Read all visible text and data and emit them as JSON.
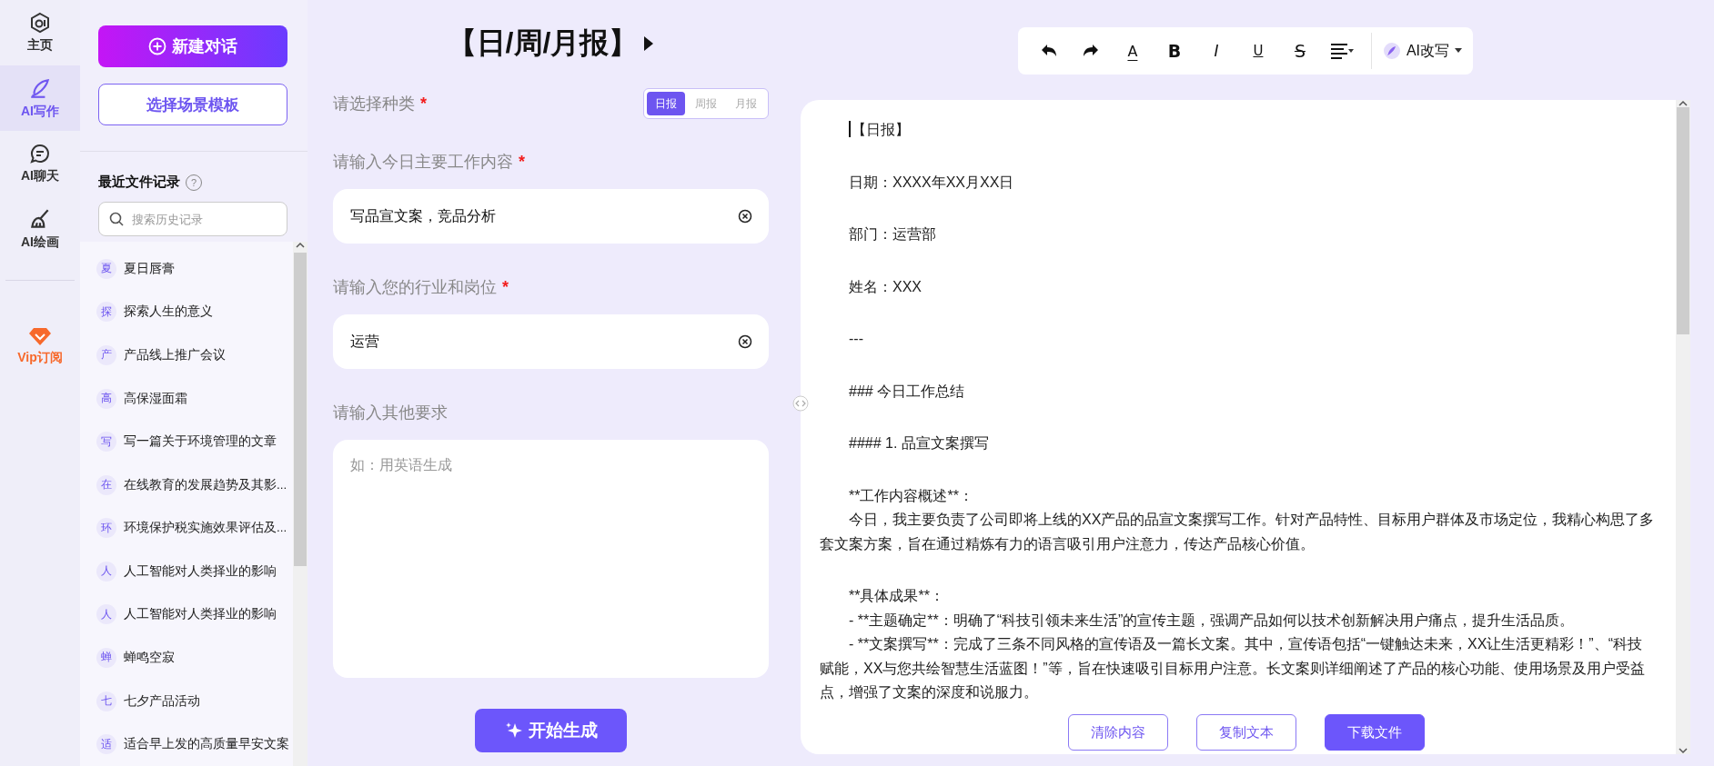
{
  "nav": [
    {
      "kind": "home",
      "label": "主页",
      "selected": false
    },
    {
      "kind": "pen",
      "label": "AI写作",
      "selected": true
    },
    {
      "kind": "chat",
      "label": "AI聊天",
      "selected": false
    },
    {
      "kind": "brush",
      "label": "AI绘画",
      "selected": false
    },
    {
      "kind": "vip",
      "label": "Vip订阅",
      "selected": false
    }
  ],
  "sidebar": {
    "new_chat": "新建对话",
    "template": "选择场景模板",
    "recent_title": "最近文件记录",
    "help_mark": "?",
    "search": {
      "placeholder": "搜索历史记录"
    },
    "files": [
      {
        "initial": "夏",
        "title": "夏日唇膏"
      },
      {
        "initial": "探",
        "title": "探索人生的意义"
      },
      {
        "initial": "产",
        "title": "产品线上推广会议"
      },
      {
        "initial": "高",
        "title": "高保湿面霜"
      },
      {
        "initial": "写",
        "title": "写一篇关于环境管理的文章"
      },
      {
        "initial": "在",
        "title": "在线教育的发展趋势及其影..."
      },
      {
        "initial": "环",
        "title": "环境保护税实施效果评估及..."
      },
      {
        "initial": "人",
        "title": "人工智能对人类择业的影响"
      },
      {
        "initial": "人",
        "title": "人工智能对人类择业的影响"
      },
      {
        "initial": "蝉",
        "title": "蝉鸣空寂"
      },
      {
        "initial": "七",
        "title": "七夕产品活动"
      },
      {
        "initial": "适",
        "title": "适合早上发的高质量早安文案"
      }
    ]
  },
  "form": {
    "title": "【日/周/月报】",
    "fields": [
      {
        "kind": "segmented",
        "label": "请选择种类",
        "mark": "*",
        "options": [
          {
            "label": "日报",
            "selected": true
          },
          {
            "label": "周报",
            "selected": false
          },
          {
            "label": "月报",
            "selected": false
          }
        ]
      },
      {
        "kind": "input",
        "label": "请输入今日主要工作内容",
        "mark": "*",
        "value": "写品宣文案，竞品分析"
      },
      {
        "kind": "input",
        "label": "请输入您的行业和岗位",
        "mark": "*",
        "value": "运营"
      },
      {
        "kind": "textarea",
        "label": "请输入其他要求",
        "placeholder": "如：用英语生成"
      }
    ],
    "submit": "开始生成"
  },
  "toolbar": {
    "tools": [
      {
        "kind": "undo"
      },
      {
        "kind": "redo"
      },
      {
        "kind": "color",
        "text": "A"
      },
      {
        "kind": "bold",
        "text": "B"
      },
      {
        "kind": "italic",
        "text": "I"
      },
      {
        "kind": "underline",
        "text": "U"
      },
      {
        "kind": "strike",
        "text": "S"
      },
      {
        "kind": "align"
      }
    ],
    "ai_rewrite": "AI改写"
  },
  "editor": {
    "blocks": [
      [
        "【日报】"
      ],
      [
        "日期：XXXX年XX月XX日"
      ],
      [
        "部门：运营部"
      ],
      [
        "姓名：XXX"
      ],
      [
        "---"
      ],
      [
        "### 今日工作总结"
      ],
      [
        "#### 1. 品宣文案撰写"
      ],
      [
        "**工作内容概述**：",
        "今日，我主要负责了公司即将上线的XX产品的品宣文案撰写工作。针对产品特性、目标用户群体及市场定位，我精心构思了多套文案方案，旨在通过精炼有力的语言吸引用户注意力，传达产品核心价值。"
      ],
      [
        "**具体成果**：",
        "- **主题确定**：明确了“科技引领未来生活”的宣传主题，强调产品如何以技术创新解决用户痛点，提升生活品质。",
        "- **文案撰写**：完成了三条不同风格的宣传语及一篇长文案。其中，宣传语包括“一键触达未来，XX让生活更精彩！”、“科技赋能，XX与您共绘智慧生活蓝图！”等，旨在快速吸引目标用户注意。长文案则详细阐述了产品的核心功能、使用场景及用户受益点，增强了文案的深度和说服力。"
      ]
    ],
    "actions": [
      {
        "kind": "outline",
        "label": "清除内容"
      },
      {
        "kind": "outline",
        "label": "复制文本"
      },
      {
        "kind": "primary",
        "label": "下载文件"
      }
    ]
  }
}
